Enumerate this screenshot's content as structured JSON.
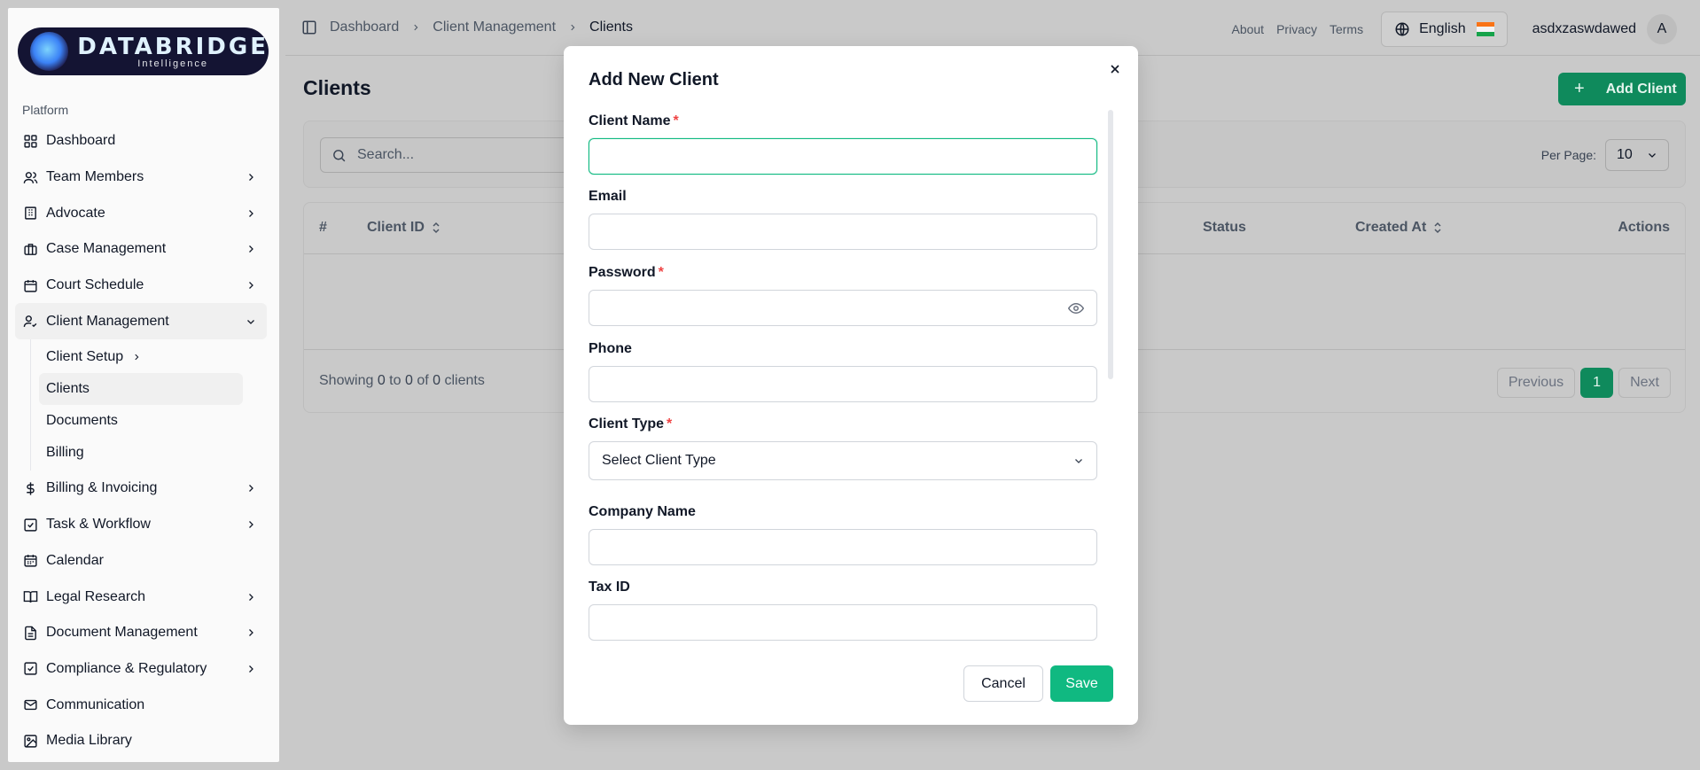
{
  "brand": {
    "title": "DATABRIDGE",
    "subtitle": "Intelligence"
  },
  "sidebar": {
    "section_label": "Platform",
    "items": [
      {
        "label": "Dashboard",
        "icon": "grid-icon",
        "chevron": false
      },
      {
        "label": "Team Members",
        "icon": "users-icon",
        "chevron": true
      },
      {
        "label": "Advocate",
        "icon": "building-icon",
        "chevron": true
      },
      {
        "label": "Case Management",
        "icon": "briefcase-icon",
        "chevron": true
      },
      {
        "label": "Court Schedule",
        "icon": "calendar-icon",
        "chevron": true
      },
      {
        "label": "Client Management",
        "icon": "user-check-icon",
        "chevron": "down",
        "active": true
      },
      {
        "label": "Billing & Invoicing",
        "icon": "dollar-icon",
        "chevron": true
      },
      {
        "label": "Task & Workflow",
        "icon": "check-square-icon",
        "chevron": true
      },
      {
        "label": "Calendar",
        "icon": "calendar-days-icon",
        "chevron": false
      },
      {
        "label": "Legal Research",
        "icon": "book-icon",
        "chevron": true
      },
      {
        "label": "Document Management",
        "icon": "file-text-icon",
        "chevron": true
      },
      {
        "label": "Compliance & Regulatory",
        "icon": "check-square-icon",
        "chevron": true
      },
      {
        "label": "Communication",
        "icon": "mail-icon",
        "chevron": false
      },
      {
        "label": "Media Library",
        "icon": "image-icon",
        "chevron": false
      }
    ],
    "client_subitems": [
      {
        "label": "Client Setup",
        "chevron": true
      },
      {
        "label": "Clients",
        "active": true
      },
      {
        "label": "Documents"
      },
      {
        "label": "Billing"
      }
    ]
  },
  "topbar": {
    "breadcrumb": [
      "Dashboard",
      "Client Management",
      "Clients"
    ],
    "links": [
      "About",
      "Privacy",
      "Terms"
    ],
    "language": "English",
    "username": "asdxzaswdawed",
    "avatar_initial": "A"
  },
  "page": {
    "title": "Clients",
    "add_button": "Add Client",
    "search_placeholder": "Search...",
    "per_page_label": "Per Page:",
    "per_page_value": "10",
    "table_headers": [
      "#",
      "Client ID",
      "Status",
      "Created At",
      "Actions"
    ],
    "showing": {
      "prefix": "Showing ",
      "from": "0",
      "to_word": " to ",
      "to": "0",
      "of_word": " of ",
      "total": "0",
      "suffix": " clients"
    },
    "pagination": {
      "previous": "Previous",
      "page": "1",
      "next": "Next"
    }
  },
  "modal": {
    "title": "Add New Client",
    "fields": {
      "client_name": {
        "label": "Client Name",
        "required": "*",
        "value": ""
      },
      "email": {
        "label": "Email",
        "value": ""
      },
      "password": {
        "label": "Password",
        "required": "*",
        "value": ""
      },
      "phone": {
        "label": "Phone",
        "value": ""
      },
      "client_type": {
        "label": "Client Type",
        "required": "*",
        "value": "Select Client Type"
      },
      "company_name": {
        "label": "Company Name",
        "value": ""
      },
      "tax_id": {
        "label": "Tax ID",
        "value": ""
      }
    },
    "cancel": "Cancel",
    "save": "Save"
  },
  "colors": {
    "accent": "#10b981",
    "accent_dim": "#0f8a5c",
    "required": "#ef4444",
    "overlay": "#c9c9c9"
  }
}
